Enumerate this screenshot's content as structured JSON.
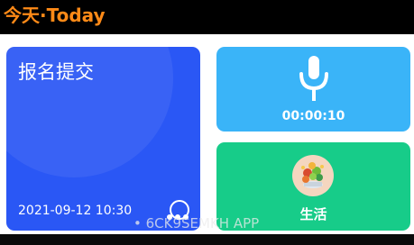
{
  "header": {
    "title": "今天·Today"
  },
  "task_card": {
    "title": "报名提交",
    "datetime": "2021-09-12 10:30",
    "more_icon": "more-dots-icon",
    "checkbox_icon": "circle-icon"
  },
  "audio_card": {
    "icon": "microphone-icon",
    "duration": "00:00:10"
  },
  "life_card": {
    "icon": "salad-avatar",
    "label": "生活"
  },
  "watermark": {
    "text": "• 6CK9SEMKH APP"
  },
  "colors": {
    "title": "#ff8a17",
    "task_card": "#2a57f5",
    "audio_card": "#3ab4f8",
    "life_card": "#17cc89"
  }
}
